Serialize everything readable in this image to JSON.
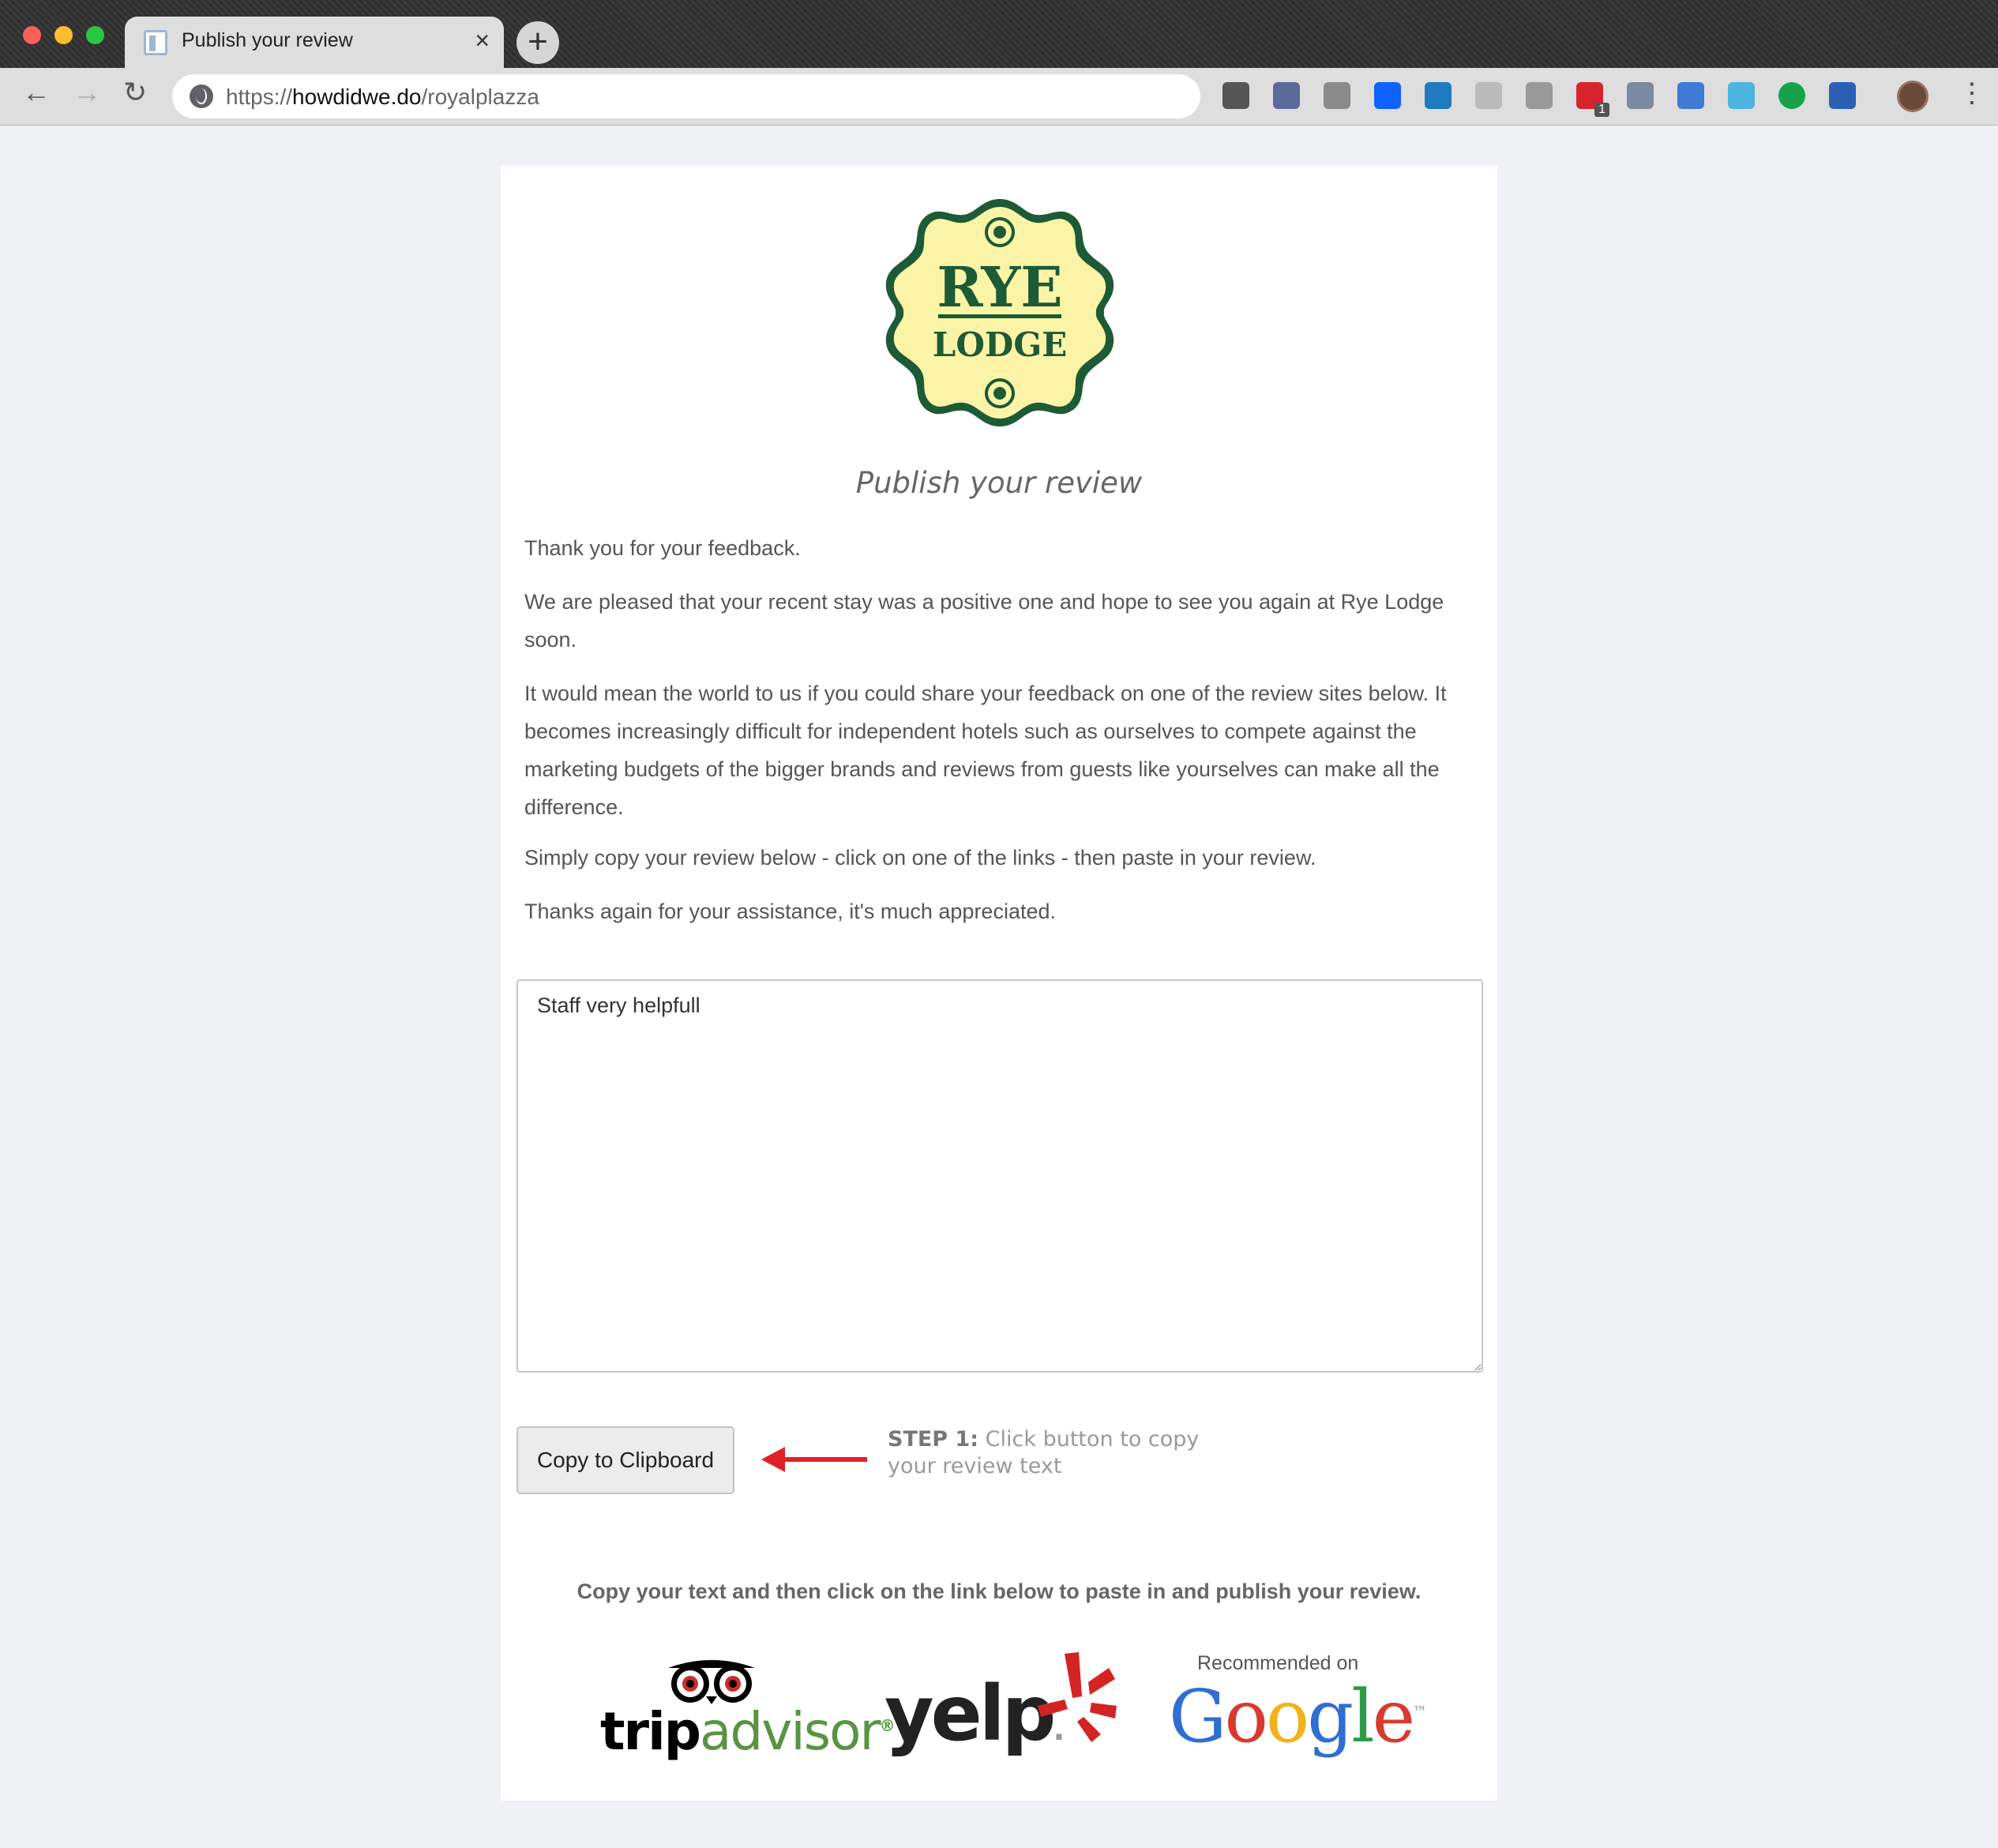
{
  "browser": {
    "tab_title": "Publish your review",
    "tab_close": "×",
    "new_tab": "+",
    "url_scheme": "https://",
    "url_host": "howdidwe.do",
    "url_path": "/royalplazza",
    "back": "←",
    "forward": "→",
    "reload": "↻",
    "menu": "⋮",
    "extensions": [
      {
        "name": "pocket-icon",
        "color": "#555555"
      },
      {
        "name": "eyedropper-icon",
        "color": "#5a6a9a"
      },
      {
        "name": "zero-icon",
        "color": "#8a8a8a"
      },
      {
        "name": "dropbox-icon",
        "color": "#0f62fe"
      },
      {
        "name": "compass-icon",
        "color": "#1e7bbf"
      },
      {
        "name": "arrow-ext-icon",
        "color": "#bbbbbb"
      },
      {
        "name": "g-ext-icon",
        "color": "#999999"
      },
      {
        "name": "todo-ext-icon",
        "color": "#d6232c",
        "badge": "1"
      },
      {
        "name": "code-ext-icon",
        "color": "#7a8aa0"
      },
      {
        "name": "sync-ext-icon",
        "color": "#3e7ad6"
      },
      {
        "name": "bird-ext-icon",
        "color": "#4bb5e0"
      },
      {
        "name": "grammarly-icon",
        "color": "#15a34a"
      },
      {
        "name": "word-icon",
        "color": "#2b5fb3"
      }
    ]
  },
  "page": {
    "logo": {
      "line1": "RYE",
      "line2": "LODGE",
      "fill": "#fbf4a6",
      "accent": "#1d5a36"
    },
    "title": "Publish your review",
    "paragraphs": [
      "Thank you for your feedback.",
      "We are pleased that your recent stay was a positive one and hope to see you again at Rye Lodge soon.",
      "It would mean the world to us if you could share your feedback on one of the review sites below.  It becomes increasingly difficult for independent hotels such as ourselves to compete against the marketing budgets of the bigger brands and reviews from guests like yourselves can make all the difference.",
      "Simply copy your review below - click on one of the links - then paste in your review.",
      "Thanks again for your assistance, it's much appreciated."
    ],
    "review_text": "Staff very helpfull",
    "copy_button": "Copy to Clipboard",
    "step_label": "STEP 1:",
    "step_text": " Click button to copy your review text",
    "instruction": "Copy your text and then click on the link below to paste in and publish your review.",
    "sites": {
      "tripadvisor": {
        "trip": "trip",
        "advisor": "advisor",
        "mark": "®"
      },
      "yelp": {
        "word": "yelp",
        "dot": "."
      },
      "google": {
        "recommended": "Recommended on",
        "letters": [
          "G",
          "o",
          "o",
          "g",
          "l",
          "e"
        ],
        "tm": "™"
      }
    }
  }
}
